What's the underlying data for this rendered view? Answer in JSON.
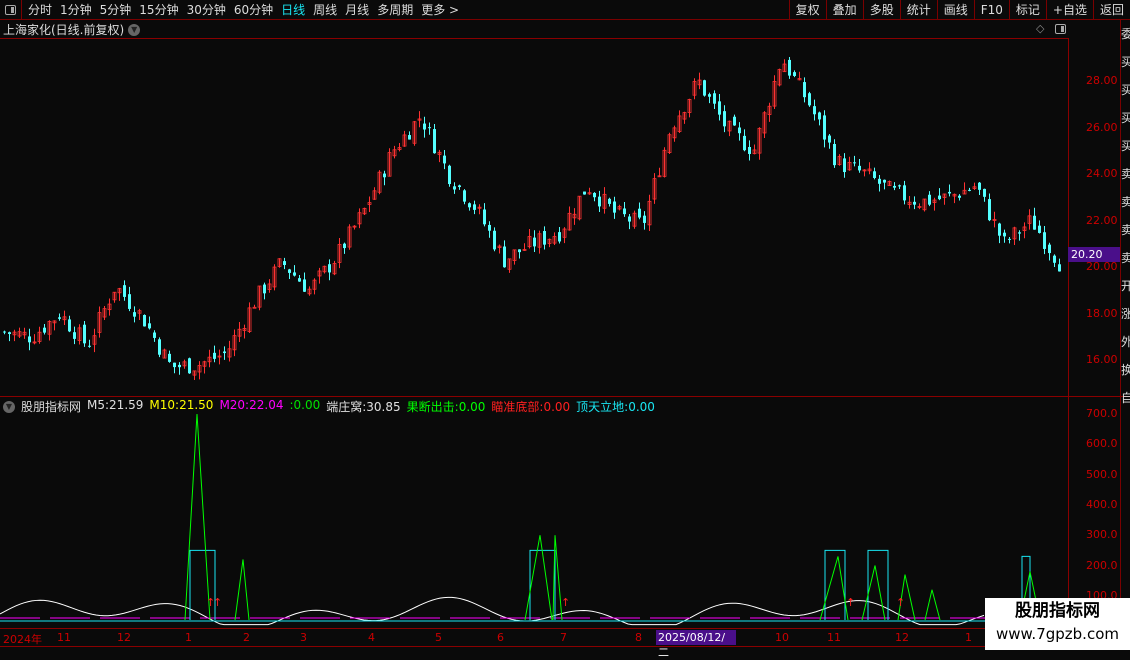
{
  "toolbar": {
    "periods": [
      "分时",
      "1分钟",
      "5分钟",
      "15分钟",
      "30分钟",
      "60分钟",
      "日线",
      "周线",
      "月线",
      "多周期",
      "更多 >"
    ],
    "active": "日线",
    "right_buttons": [
      "复权",
      "叠加",
      "多股",
      "统计",
      "画线",
      "F10",
      "标记",
      "+自选",
      "返回"
    ]
  },
  "title": "上海家化(日线.前复权)",
  "price_axis": {
    "ticks": [
      "28.00",
      "26.00",
      "24.00",
      "22.00",
      "20.00",
      "18.00",
      "16.00"
    ],
    "current": "20.20"
  },
  "indicator": {
    "name": "股朋指标网",
    "items": [
      {
        "label": "M5:",
        "value": "21.59",
        "color": "#e0e0e0"
      },
      {
        "label": "M10:",
        "value": "21.50",
        "color": "#ffff00"
      },
      {
        "label": "M20:",
        "value": "22.04",
        "color": "#ff00ff"
      },
      {
        "label": ":",
        "value": "0.00",
        "color": "#00e000"
      },
      {
        "label": "端庄窝:",
        "value": "30.85",
        "color": "#e0e0e0"
      },
      {
        "label": "果断出击:",
        "value": "0.00",
        "color": "#00ff00"
      },
      {
        "label": "瞄准底部:",
        "value": "0.00",
        "color": "#ff2020"
      },
      {
        "label": "顶天立地:",
        "value": "0.00",
        "color": "#19e6f2"
      }
    ],
    "ticks": [
      "700.0",
      "600.0",
      "500.0",
      "400.0",
      "300.0",
      "200.0",
      "100.0"
    ]
  },
  "xaxis": {
    "labels": [
      "2024年",
      "11",
      "12",
      "1",
      "2",
      "3",
      "4",
      "5",
      "6",
      "7",
      "8",
      "10",
      "11",
      "12",
      "1"
    ],
    "cursor_date": "2025/08/12/二"
  },
  "watermark": {
    "line1": "股朋指标网",
    "line2": "www.7gpzb.com"
  },
  "chart_data": {
    "type": "candlestick",
    "price_keypoints": [
      17.2,
      17,
      18,
      16.6,
      19.2,
      17.8,
      15.7,
      15.8,
      16.3,
      18.5,
      20.2,
      19,
      20.5,
      22.5,
      25,
      26.5,
      24,
      22.5,
      20.3,
      21,
      21.5,
      23.5,
      22.3,
      21.8,
      26,
      28,
      26,
      25,
      29,
      27,
      24.5,
      24,
      23.2,
      22.8,
      23,
      23.5,
      21,
      22,
      20.2
    ],
    "ylim": [
      15,
      30
    ],
    "indicator_ylim": [
      0,
      720
    ],
    "colors": {
      "up": "#ff3232",
      "down": "#54ffff",
      "ma": "#ffffff"
    }
  }
}
